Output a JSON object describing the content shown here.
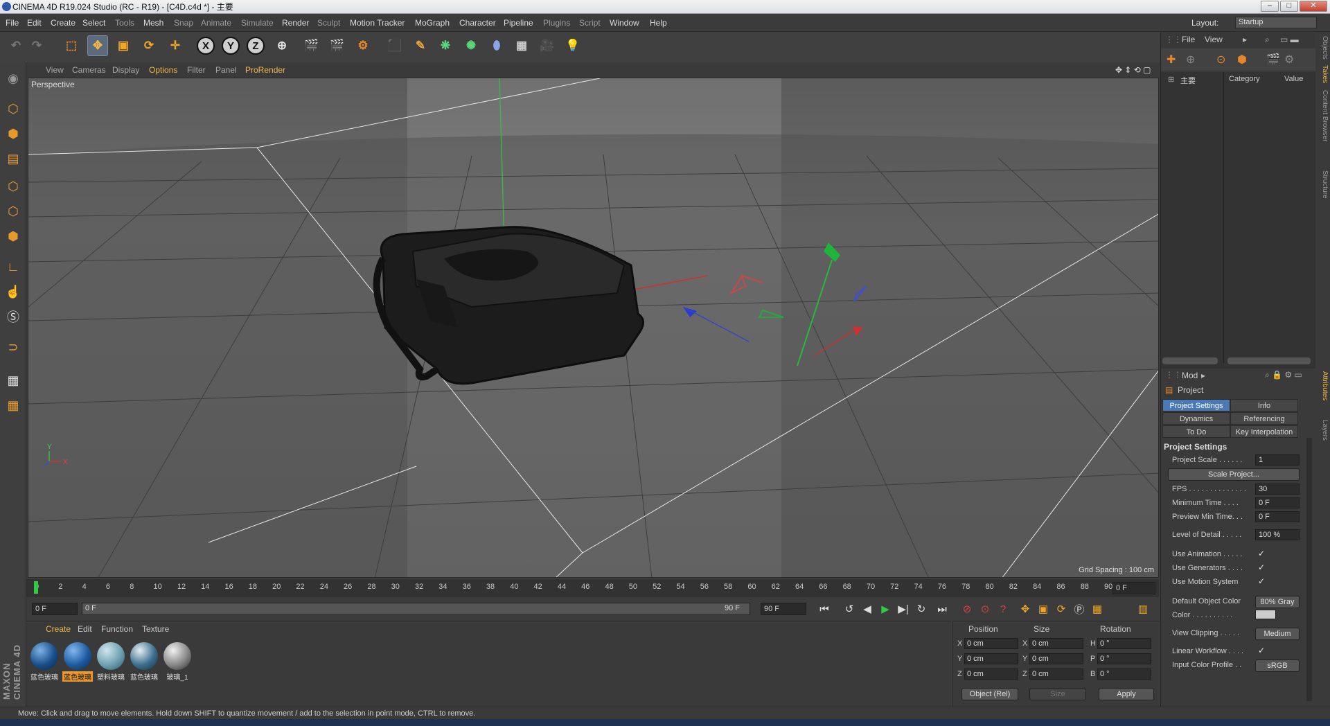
{
  "window": {
    "title": "CINEMA 4D R19.024 Studio (RC - R19) - [C4D.c4d *] - 主要",
    "min": "–",
    "max": "□",
    "close": "✕"
  },
  "menubar": {
    "items": [
      "File",
      "Edit",
      "Create",
      "Select",
      "Tools",
      "Mesh",
      "Snap",
      "Animate",
      "Simulate",
      "Render",
      "Sculpt",
      "Motion Tracker",
      "MoGraph",
      "Character",
      "Pipeline",
      "Plugins",
      "Script",
      "Window",
      "Help"
    ],
    "layout_label": "Layout:",
    "layout_value": "Startup"
  },
  "toolbar": {
    "x_axis": "X",
    "y_axis": "Y",
    "z_axis": "Z"
  },
  "viewport": {
    "menu": [
      "View",
      "Cameras",
      "Display",
      "Options",
      "Filter",
      "Panel",
      "ProRender"
    ],
    "active_menu": "Options",
    "label": "Perspective",
    "grid_spacing": "Grid Spacing : 100 cm",
    "axis_y": "Y",
    "axis_x": "X"
  },
  "timeline": {
    "ticks": [
      "0",
      "2",
      "4",
      "6",
      "8",
      "10",
      "12",
      "14",
      "16",
      "18",
      "20",
      "22",
      "24",
      "26",
      "28",
      "30",
      "32",
      "34",
      "36",
      "38",
      "40",
      "42",
      "44",
      "46",
      "48",
      "50",
      "52",
      "54",
      "56",
      "58",
      "60",
      "62",
      "64",
      "66",
      "68",
      "70",
      "72",
      "74",
      "76",
      "78",
      "80",
      "82",
      "84",
      "86",
      "88",
      "90"
    ],
    "current_frame": "0 F",
    "start_field": "0 F",
    "range_start": "0 F",
    "range_end": "90 F",
    "end_field": "90 F",
    "playhead_fraction": 0
  },
  "material_manager": {
    "tabs": [
      "Create",
      "Edit",
      "Function",
      "Texture"
    ],
    "active_tab": "Texture",
    "materials": [
      {
        "name": "蓝色玻璃",
        "color": "#1a4e8a",
        "selected": false
      },
      {
        "name": "蓝色玻璃",
        "color": "#1d5aa0",
        "selected": true
      },
      {
        "name": "塑料玻璃",
        "color": "#6fa1b2",
        "selected": false
      },
      {
        "name": "蓝色玻璃",
        "color": "#3b6f8e",
        "selected": false
      },
      {
        "name": "玻璃_1",
        "color": "#888888",
        "selected": false
      }
    ]
  },
  "coordinates": {
    "headers": [
      "Position",
      "Size",
      "Rotation"
    ],
    "rows": [
      {
        "axis": "X",
        "pos": "0 cm",
        "size_axis": "X",
        "size": "0 cm",
        "rot_axis": "H",
        "rot": "0 °"
      },
      {
        "axis": "Y",
        "pos": "0 cm",
        "size_axis": "Y",
        "size": "0 cm",
        "rot_axis": "P",
        "rot": "0 °"
      },
      {
        "axis": "Z",
        "pos": "0 cm",
        "size_axis": "Z",
        "size": "0 cm",
        "rot_axis": "B",
        "rot": "0 °"
      }
    ],
    "mode": "Object (Rel)",
    "size_mode": "Size",
    "apply": "Apply"
  },
  "status": "Move: Click and drag to move elements. Hold down SHIFT to quantize movement / add to the selection in point mode, CTRL to remove.",
  "object_manager": {
    "menu": [
      "File",
      "View"
    ],
    "columns": [
      "主要",
      "Category",
      "Value"
    ]
  },
  "side_tabs": [
    "Objects",
    "Takes",
    "Content Browser",
    "Structure",
    "Attributes",
    "Layers"
  ],
  "attributes": {
    "mode": "Mod",
    "title": "Project",
    "tabs": [
      {
        "label": "Project Settings",
        "active": true
      },
      {
        "label": "Info",
        "active": false
      },
      {
        "label": "Dynamics",
        "active": false
      },
      {
        "label": "Referencing",
        "active": false
      },
      {
        "label": "To Do",
        "active": false
      },
      {
        "label": "Key Interpolation",
        "active": false
      }
    ],
    "section": "Project Settings",
    "project_scale_label": "Project Scale . . . . . .",
    "project_scale": "1",
    "scale_project_button": "Scale Project...",
    "fps_label": "FPS . . . . . . . . . . . . . .",
    "fps": "30",
    "min_time_label": "Minimum Time . . . .",
    "min_time": "0 F",
    "preview_min_label": "Preview Min Time. . .",
    "preview_min": "0 F",
    "lod_label": "Level of Detail . . . . .",
    "lod": "100 %",
    "use_animation_label": "Use Animation . . . . .",
    "use_generators_label": "Use Generators . . . .",
    "use_motion_label": "Use Motion System",
    "check": "✓",
    "default_color_label": "Default Object Color",
    "default_color": "80% Gray",
    "color_label": "Color . . . . . . . . . .",
    "view_clipping_label": "View Clipping . . . . .",
    "view_clipping": "Medium",
    "linear_workflow_label": "Linear Workflow . . . .",
    "input_color_label": "Input Color Profile . .",
    "input_color": "sRGB"
  }
}
